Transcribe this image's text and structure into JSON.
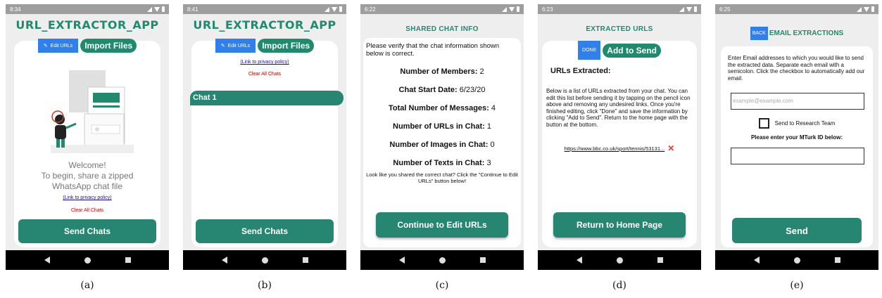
{
  "nav": {
    "back": "back-icon",
    "home": "home-icon",
    "recent": "recent-apps-icon"
  },
  "screens": {
    "a": {
      "time": "8:34",
      "title": "URL_EXTRACTOR_APP",
      "edit_tab": "Edit URLs",
      "import_tab": "Import Files",
      "welcome_line1": "Welcome!",
      "welcome_line2": "To begin, share a zipped",
      "welcome_line3": "WhatsApp chat file",
      "privacy_link": "(Link to privacy policy)",
      "clear_chats": "Clear All Chats",
      "send_button": "Send Chats",
      "caption": "(a)"
    },
    "b": {
      "time": "8:41",
      "title": "URL_EXTRACTOR_APP",
      "edit_tab": "Edit URLs",
      "import_tab": "Import Files",
      "privacy_link": "(Link to privacy policy)",
      "clear_chats": "Clear All Chats",
      "chat_item": "Chat 1",
      "send_button": "Send Chats",
      "caption": "(b)"
    },
    "c": {
      "time": "6:22",
      "title": "SHARED CHAT INFO",
      "intro": "Please verify that the chat information shown below is correct.",
      "members_label": "Number of Members:",
      "members_value": "2",
      "start_label": "Chat Start Date:",
      "start_value": "6/23/20",
      "messages_label": "Total Number of Messages:",
      "messages_value": "4",
      "urls_label": "Number of URLs in Chat:",
      "urls_value": "1",
      "images_label": "Number of Images in Chat:",
      "images_value": "0",
      "texts_label": "Number of Texts in Chat:",
      "texts_value": "3",
      "note": "Look like you shared the correct chat? Click the \"Continue to Edit URLs\" button below!",
      "continue_button": "Continue to Edit URLs",
      "caption": "(c)"
    },
    "d": {
      "time": "6:23",
      "title": "EXTRACTED URLS",
      "done_button": "DONE",
      "add_button": "Add to Send",
      "heading": "URLs Extracted:",
      "body": "Below is a list of URLs extracted from your chat. You can edit this list before sending it by tapping on the pencil icon above and removing any undesired links. Once you're finished editing, click \"Done\" and save the information by clicking \"Add to Send\". Return to the home page with the button at the bottom.",
      "url": "https://www.bbc.co.uk/sport/tennis/53131...",
      "return_button": "Return to Home Page",
      "caption": "(d)"
    },
    "e": {
      "time": "6:25",
      "back_button": "BACK",
      "title": "EMAIL EXTRACTIONS",
      "instructions": "Enter Email addresses to which you would like to send the extracted data. Separate each email with a semicolon. Click the checkbox to automatically add our email.",
      "email_placeholder": "example@example.com",
      "checkbox_label": "Send to Research Team",
      "mturk_label": "Please enter your MTurk ID below:",
      "send_button": "Send",
      "caption": "(e)"
    }
  }
}
